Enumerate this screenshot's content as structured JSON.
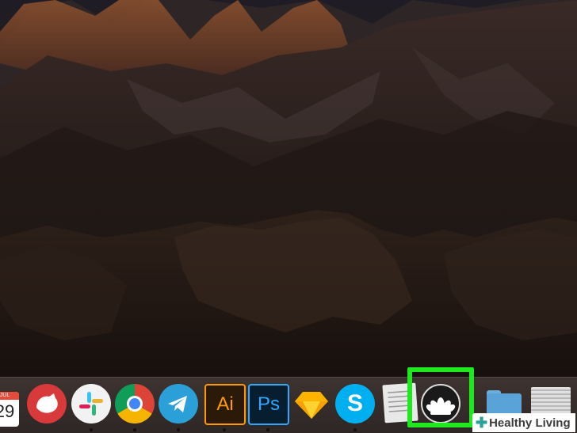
{
  "dock": {
    "items": [
      {
        "name": "Calendar",
        "icon": "calendar-icon",
        "month": "JUL",
        "day": "29"
      },
      {
        "name": "Bear",
        "icon": "bear-icon"
      },
      {
        "name": "Slack",
        "icon": "slack-icon"
      },
      {
        "name": "Google Chrome",
        "icon": "chrome-icon"
      },
      {
        "name": "Telegram",
        "icon": "telegram-icon"
      },
      {
        "name": "Adobe Illustrator",
        "icon": "illustrator-icon",
        "label": "Ai"
      },
      {
        "name": "Adobe Photoshop",
        "icon": "photoshop-icon",
        "label": "Ps"
      },
      {
        "name": "Sketch",
        "icon": "sketch-icon"
      },
      {
        "name": "Skype",
        "icon": "skype-icon"
      },
      {
        "name": "Document",
        "icon": "document-icon"
      },
      {
        "name": "Lotus app",
        "icon": "lotus-icon"
      },
      {
        "name": "Folder",
        "icon": "folder-icon"
      },
      {
        "name": "Stack",
        "icon": "stack-icon"
      }
    ]
  },
  "watermark": {
    "text": "Healthy Living"
  },
  "colors": {
    "highlight": "#1fe81f",
    "accent": "#2aa198"
  }
}
